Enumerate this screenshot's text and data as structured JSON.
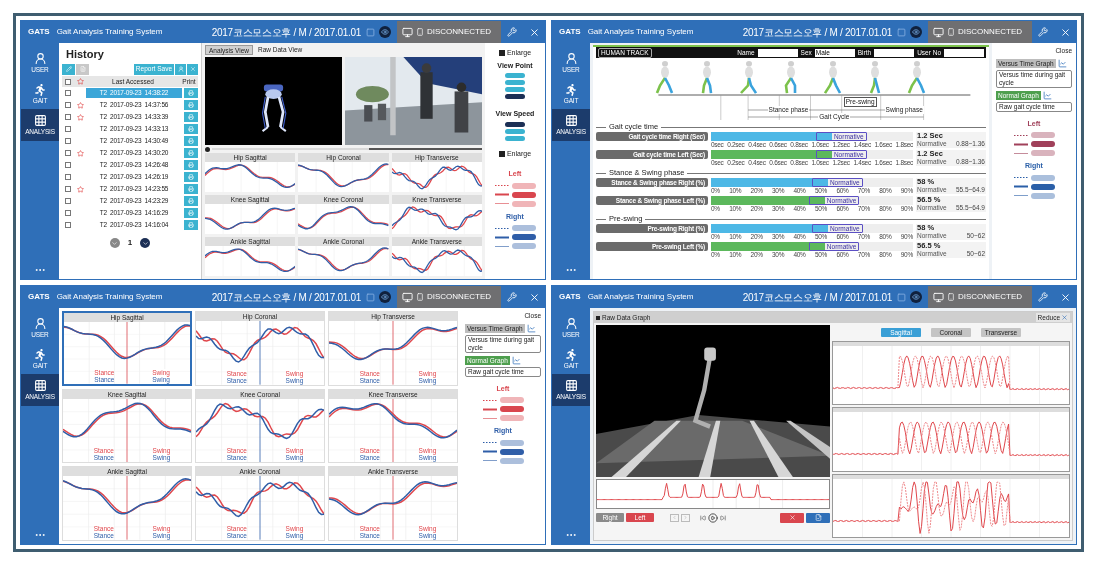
{
  "windows": [
    {
      "kind": "history",
      "header": {
        "logo": "GATS",
        "title": "Gait Analysis Training System",
        "patient": "2017코스모스오후 / M / 2017.01.01",
        "status": "DISCONNECTED"
      },
      "nav": [
        {
          "kind": "user",
          "label": "USER",
          "selected": false
        },
        {
          "kind": "gait",
          "label": "GAIT",
          "selected": false
        },
        {
          "kind": "analysis",
          "label": "ANALYSIS",
          "selected": true
        }
      ],
      "history": {
        "title": "History",
        "report_button": "Report Save",
        "header_checked": false,
        "columns": [
          "Last Accessed",
          "Print"
        ],
        "rows": [
          {
            "checked": false,
            "starred": false,
            "selected": true,
            "text": "T2  2017-09-23  14:38:22"
          },
          {
            "checked": false,
            "starred": true,
            "selected": false,
            "text": "T2  2017-09-23  14:37:56"
          },
          {
            "checked": false,
            "starred": true,
            "selected": false,
            "text": "T2  2017-09-23  14:33:39"
          },
          {
            "checked": false,
            "starred": false,
            "selected": false,
            "text": "T2  2017-09-23  14:33:13"
          },
          {
            "checked": false,
            "starred": false,
            "selected": false,
            "text": "T2  2017-09-23  14:30:49"
          },
          {
            "checked": false,
            "starred": true,
            "selected": false,
            "text": "T2  2017-09-23  14:30:20"
          },
          {
            "checked": false,
            "starred": false,
            "selected": false,
            "text": "T2  2017-09-23  14:26:48"
          },
          {
            "checked": false,
            "starred": false,
            "selected": false,
            "text": "T2  2017-09-23  14:26:19"
          },
          {
            "checked": false,
            "starred": true,
            "selected": false,
            "text": "T2  2017-09-23  14:23:55"
          },
          {
            "checked": false,
            "starred": false,
            "selected": false,
            "text": "T2  2017-09-23  14:23:29"
          },
          {
            "checked": false,
            "starred": false,
            "selected": false,
            "text": "T2  2017-09-23  14:16:29"
          },
          {
            "checked": false,
            "starred": false,
            "selected": false,
            "text": "T2  2017-09-23  14:16:04"
          }
        ],
        "page": "1"
      },
      "tabs": [
        {
          "label": "Analysis View",
          "selected": true
        },
        {
          "label": "Raw Data View",
          "selected": false
        }
      ],
      "playback": {
        "level": 0.58
      },
      "charts": [
        {
          "title": "Hip Sagittal"
        },
        {
          "title": "Hip Coronal"
        },
        {
          "title": "Hip Transverse"
        },
        {
          "title": "Knee Sagittal"
        },
        {
          "title": "Knee Coronal"
        },
        {
          "title": "Knee Transverse"
        },
        {
          "title": "Ankle Sagittal"
        },
        {
          "title": "Ankle Coronal"
        },
        {
          "title": "Ankle Transverse"
        }
      ],
      "side": {
        "enlarge": "Enlarge",
        "view_point": "View Point",
        "view_points": [
          {
            "selected": false
          },
          {
            "selected": false
          },
          {
            "selected": false
          },
          {
            "selected": true
          }
        ],
        "view_speed": "View Speed",
        "speeds": [
          {
            "selected": true
          },
          {
            "selected": false
          },
          {
            "selected": false
          }
        ],
        "enlarge_charts": "Enlarge"
      },
      "legend": [
        {
          "label": "Left",
          "color": "#d9464e"
        },
        {
          "label": "Right",
          "color": "#2f5ea8"
        }
      ]
    },
    {
      "kind": "gait_report",
      "header": {
        "logo": "GATS",
        "title": "Gait Analysis Training System",
        "patient": "2017코스모스오후 / M / 2017.01.01",
        "status": "DISCONNECTED"
      },
      "nav": [
        {
          "kind": "user",
          "label": "USER",
          "selected": false
        },
        {
          "kind": "gait",
          "label": "GAIT",
          "selected": false
        },
        {
          "kind": "analysis",
          "label": "ANALYSIS",
          "selected": true
        }
      ],
      "track": {
        "label": "HUMAN TRACK",
        "fields": [
          {
            "label": "Name"
          },
          {
            "label": "Sex",
            "value": "Male"
          },
          {
            "label": "Birth"
          },
          {
            "label": "User No"
          }
        ]
      },
      "timeline": {
        "pre_swing": "Pre-swing",
        "stance": "Stance phase",
        "swing": "Swing phase",
        "cycle": "Gait Cycle"
      },
      "sections": [
        {
          "title": "Gait cycle time",
          "rows": [
            {
              "label": "Gait cycle time Right (Sec)",
              "color": "#4db8e6",
              "level": 0.6,
              "normative_tag": "Normative",
              "value": "1.2 Sec",
              "normative": "Normative",
              "range": "0.88~1.36",
              "ticks": [
                "0sec",
                "0.2sec",
                "0.4sec",
                "0.6sec",
                "0.8sec",
                "1.0sec",
                "1.2sec",
                "1.4sec",
                "1.6sec",
                "1.8sec"
              ]
            },
            {
              "label": "Gait cycle time Left (Sec)",
              "color": "#5cb85c",
              "level": 0.6,
              "normative_tag": "Normative",
              "value": "1.2 Sec",
              "normative": "Normative",
              "range": "0.88~1.36",
              "ticks": [
                "0sec",
                "0.2sec",
                "0.4sec",
                "0.6sec",
                "0.8sec",
                "1.0sec",
                "1.2sec",
                "1.4sec",
                "1.6sec",
                "1.8sec"
              ]
            }
          ]
        },
        {
          "title": "Stance & Swing phase",
          "rows": [
            {
              "label": "Stance & Swing phase Right (%)",
              "color": "#4db8e6",
              "level": 0.58,
              "normative_tag": "Normative",
              "value": "58 %",
              "normative": "Normative",
              "range": "55.5~64.9",
              "ticks": [
                "0%",
                "10%",
                "20%",
                "30%",
                "40%",
                "50%",
                "60%",
                "70%",
                "80%",
                "90%"
              ]
            },
            {
              "label": "Stance & Swing phase Left (%)",
              "color": "#5cb85c",
              "level": 0.565,
              "normative_tag": "Normative",
              "value": "56.5 %",
              "normative": "Normative",
              "range": "55.5~64.9",
              "ticks": [
                "0%",
                "10%",
                "20%",
                "30%",
                "40%",
                "50%",
                "60%",
                "70%",
                "80%",
                "90%"
              ]
            }
          ]
        },
        {
          "title": "Pre-swing",
          "rows": [
            {
              "label": "Pre-swing Right (%)",
              "color": "#4db8e6",
              "level": 0.58,
              "normative_tag": "Normative",
              "value": "58 %",
              "normative": "Normative",
              "range": "50~62",
              "ticks": [
                "0%",
                "10%",
                "20%",
                "30%",
                "40%",
                "50%",
                "60%",
                "70%",
                "80%",
                "90%"
              ]
            },
            {
              "label": "Pre-swing Left (%)",
              "color": "#5cb85c",
              "level": 0.565,
              "normative_tag": "Normative",
              "value": "56.5 %",
              "normative": "Normative",
              "range": "50~62",
              "ticks": [
                "0%",
                "10%",
                "20%",
                "30%",
                "40%",
                "50%",
                "60%",
                "70%",
                "80%",
                "90%"
              ]
            }
          ]
        }
      ],
      "panel": {
        "close": "Close",
        "graphs": [
          {
            "label": "Versus Time Graph",
            "selected": false,
            "field": "Versus time during gait cycle"
          },
          {
            "label": "Normal Graph",
            "selected": true,
            "field": "Raw gait cycle time"
          }
        ]
      },
      "legend": [
        {
          "label": "Left",
          "color": "#a0405a"
        },
        {
          "label": "Right",
          "color": "#2a5fa8"
        }
      ]
    },
    {
      "kind": "charts",
      "header": {
        "logo": "GATS",
        "title": "Gait Analysis Training System",
        "patient": "2017코스모스오후 / M / 2017.01.01",
        "status": "DISCONNECTED"
      },
      "nav": [
        {
          "kind": "user",
          "label": "USER",
          "selected": false
        },
        {
          "kind": "gait",
          "label": "GAIT",
          "selected": false
        },
        {
          "kind": "analysis",
          "label": "ANALYSIS",
          "selected": true
        }
      ],
      "charts": [
        {
          "title": "Hip Sagittal",
          "selected": true,
          "phases": {
            "left": [
              "Stance",
              "Swing"
            ],
            "right": [
              "Stance",
              "Swing"
            ]
          }
        },
        {
          "title": "Hip Coronal",
          "selected": false,
          "phases": {
            "left": [
              "Stance",
              "Swing"
            ],
            "right": [
              "Stance",
              "Swing"
            ]
          }
        },
        {
          "title": "Hip Transverse",
          "selected": false,
          "phases": {
            "left": [
              "Stance",
              "Swing"
            ],
            "right": [
              "Stance",
              "Swing"
            ]
          }
        },
        {
          "title": "Knee Sagittal",
          "selected": false,
          "phases": {
            "left": [
              "Stance",
              "Swing"
            ],
            "right": [
              "Stance",
              "Swing"
            ]
          }
        },
        {
          "title": "Knee Coronal",
          "selected": false,
          "phases": {
            "left": [
              "Stance",
              "Swing"
            ],
            "right": [
              "Stance",
              "Swing"
            ]
          }
        },
        {
          "title": "Knee Transverse",
          "selected": false,
          "phases": {
            "left": [
              "Stance",
              "Swing"
            ],
            "right": [
              "Stance",
              "Swing"
            ]
          }
        },
        {
          "title": "Ankle Sagittal",
          "selected": false,
          "phases": {
            "left": [
              "Stance",
              "Swing"
            ],
            "right": [
              "Stance",
              "Swing"
            ]
          }
        },
        {
          "title": "Ankle Coronal",
          "selected": false,
          "phases": {
            "left": [
              "Stance",
              "Swing"
            ],
            "right": [
              "Stance",
              "Swing"
            ]
          }
        },
        {
          "title": "Ankle Transverse",
          "selected": false,
          "phases": {
            "left": [
              "Stance",
              "Swing"
            ],
            "right": [
              "Stance",
              "Swing"
            ]
          }
        }
      ],
      "panel": {
        "close": "Close",
        "graphs": [
          {
            "label": "Versus Time Graph",
            "selected": false,
            "field": "Versus time during gait cycle"
          },
          {
            "label": "Normal Graph",
            "selected": true,
            "field": "Raw gait cycle time"
          }
        ]
      },
      "legend": [
        {
          "label": "Left",
          "color": "#d9464e"
        },
        {
          "label": "Right",
          "color": "#2f5ea8"
        }
      ]
    },
    {
      "kind": "raw",
      "header": {
        "logo": "GATS",
        "title": "Gait Analysis Training System",
        "patient": "2017코스모스오후 / M / 2017.01.01",
        "status": "DISCONNECTED"
      },
      "nav": [
        {
          "kind": "user",
          "label": "USER",
          "selected": false
        },
        {
          "kind": "gait",
          "label": "GAIT",
          "selected": false
        },
        {
          "kind": "analysis",
          "label": "ANALYSIS",
          "selected": true
        }
      ],
      "raw": {
        "title": "Raw Data Graph",
        "reduce": "Reduce",
        "sides": [
          {
            "label": "Right",
            "selected": false
          },
          {
            "label": "Left",
            "selected": true
          }
        ],
        "planes": [
          {
            "label": "Sagittal",
            "selected": true
          },
          {
            "label": "Coronal",
            "selected": false
          },
          {
            "label": "Transverse",
            "selected": false
          }
        ]
      }
    }
  ]
}
